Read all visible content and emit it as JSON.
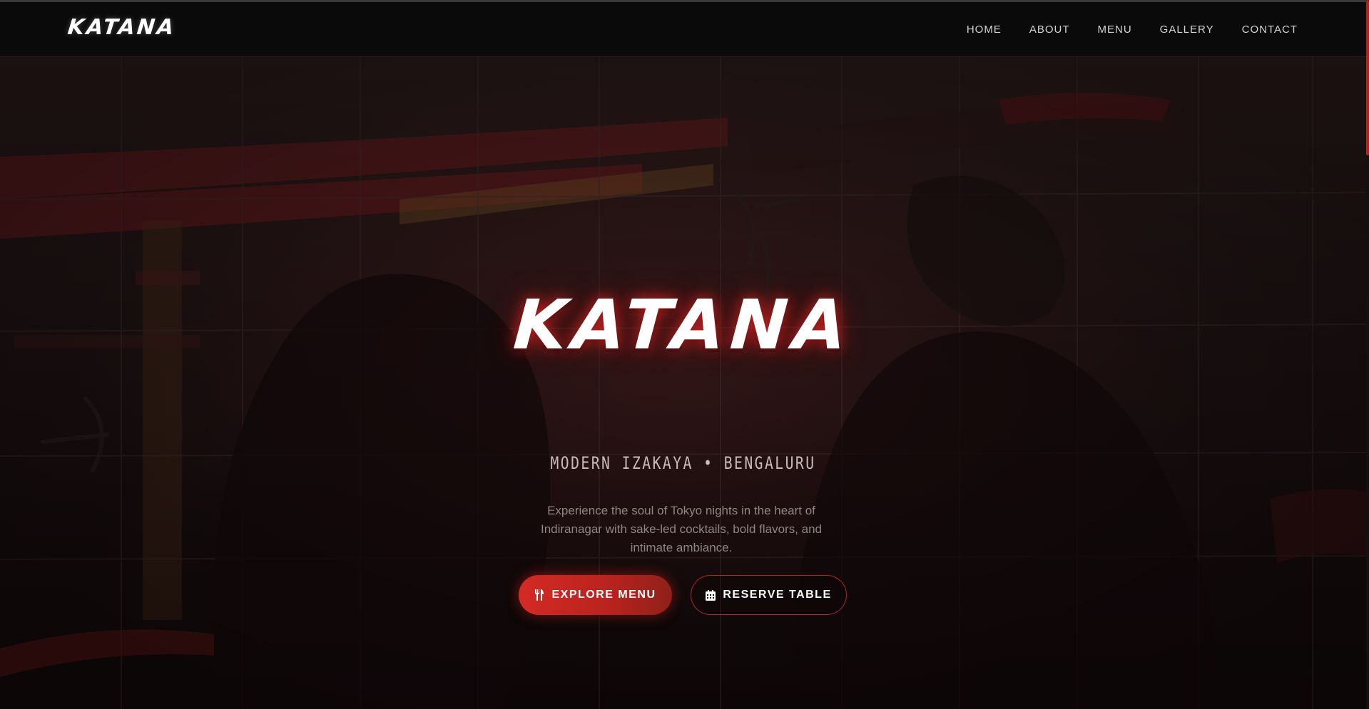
{
  "nav": {
    "brand": "KATANA",
    "links": [
      {
        "label": "HOME"
      },
      {
        "label": "ABOUT"
      },
      {
        "label": "MENU"
      },
      {
        "label": "GALLERY"
      },
      {
        "label": "CONTACT"
      }
    ]
  },
  "hero": {
    "title": "KATANA",
    "subtitle": "MODERN IZAKAYA • BENGALURU",
    "description": "Experience the soul of Tokyo nights in the heart of Indiranagar with sake-led cocktails, bold flavors, and intimate ambiance.",
    "primary_button": {
      "label": "EXPLORE MENU",
      "icon": "utensils-icon"
    },
    "secondary_button": {
      "label": "RESERVE TABLE",
      "icon": "calendar-icon"
    }
  },
  "colors": {
    "accent": "#c8251f",
    "nav_background": "#0b0a0a",
    "hero_background": "#1e1213",
    "text_primary": "#ffffff",
    "text_muted": "#8f8585"
  }
}
